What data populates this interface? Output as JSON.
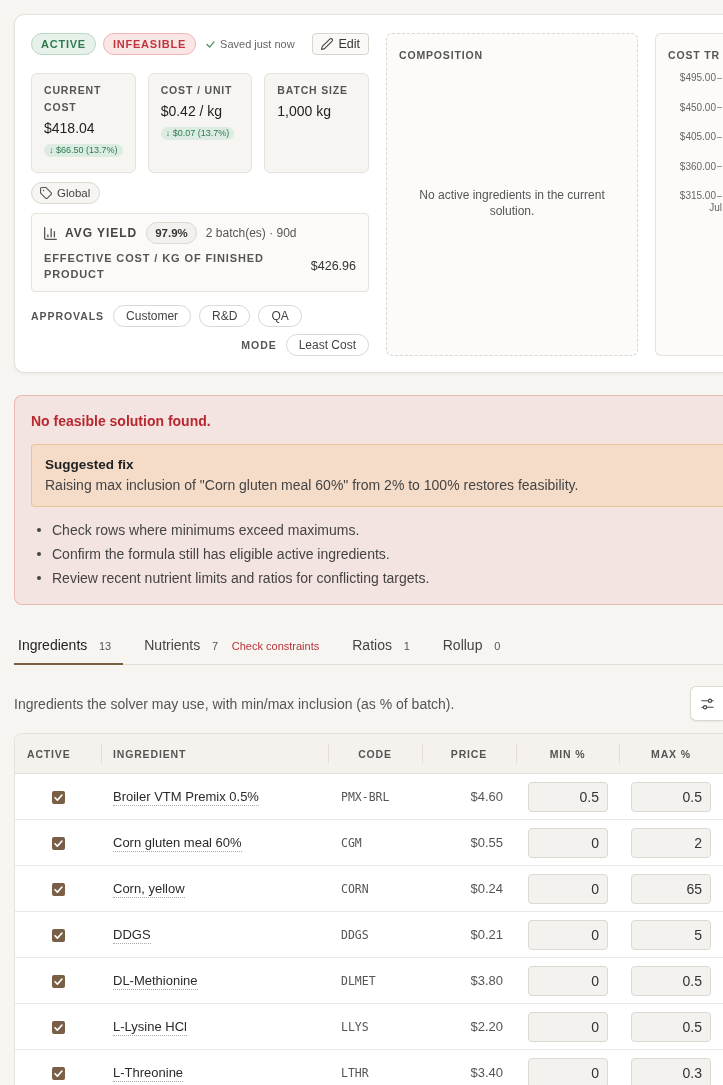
{
  "header": {
    "statuses": [
      {
        "label": "ACTIVE",
        "kind": "success"
      },
      {
        "label": "INFEASIBLE",
        "kind": "danger"
      }
    ],
    "save_status": "Saved just now",
    "edit_button": "Edit"
  },
  "metrics": [
    {
      "label": "CURRENT COST",
      "value": "$418.04",
      "delta": "↓ $66.50 (13.7%)"
    },
    {
      "label": "COST / UNIT",
      "value": "$0.42 / kg",
      "delta": "↓ $0.07 (13.7%)"
    },
    {
      "label": "BATCH SIZE",
      "value": "1,000 kg"
    }
  ],
  "tags": [
    "Global"
  ],
  "yield": {
    "label": "AVG YIELD",
    "value": "97.9%",
    "detail": "2 batch(es) · 90d",
    "effective_cost_label": "EFFECTIVE COST / KG OF FINISHED PRODUCT",
    "effective_cost_value": "$426.96"
  },
  "approvals": {
    "label": "APPROVALS",
    "items": [
      "Customer",
      "R&D",
      "QA"
    ]
  },
  "mode": {
    "label": "MODE",
    "value": "Least Cost"
  },
  "composition": {
    "title": "COMPOSITION",
    "empty_message": "No active ingredients in the current solution."
  },
  "cost_trend": {
    "title": "COST TR",
    "y_ticks": [
      "$495.00",
      "$450.00",
      "$405.00",
      "$360.00",
      "$315.00"
    ],
    "x_ticks": [
      "Jul"
    ]
  },
  "alert": {
    "title": "No feasible solution found.",
    "suggestion": {
      "title": "Suggested fix",
      "text": "Raising max inclusion of \"Corn gluten meal 60%\" from 2% to 100% restores feasibility."
    },
    "tips": [
      "Check rows where minimums exceed maximums.",
      "Confirm the formula still has eligible active ingredients.",
      "Review recent nutrient limits and ratios for conflicting targets."
    ]
  },
  "tabs": [
    {
      "label": "Ingredients",
      "count": "13",
      "selected": true
    },
    {
      "label": "Nutrients",
      "count": "7",
      "warning": "Check constraints",
      "selected": false
    },
    {
      "label": "Ratios",
      "count": "1",
      "selected": false
    },
    {
      "label": "Rollup",
      "count": "0",
      "selected": false
    }
  ],
  "description": "Ingredients the solver may use, with min/max inclusion (as % of batch).",
  "table": {
    "columns": [
      "ACTIVE",
      "INGREDIENT",
      "CODE",
      "PRICE",
      "MIN %",
      "MAX %"
    ],
    "rows": [
      {
        "active": true,
        "ingredient": "Broiler VTM Premix 0.5%",
        "code": "PMX-BRL",
        "price": "$4.60",
        "min": "0.5",
        "max": "0.5"
      },
      {
        "active": true,
        "ingredient": "Corn gluten meal 60%",
        "code": "CGM",
        "price": "$0.55",
        "min": "0",
        "max": "2"
      },
      {
        "active": true,
        "ingredient": "Corn, yellow",
        "code": "CORN",
        "price": "$0.24",
        "min": "0",
        "max": "65"
      },
      {
        "active": true,
        "ingredient": "DDGS",
        "code": "DDGS",
        "price": "$0.21",
        "min": "0",
        "max": "5"
      },
      {
        "active": true,
        "ingredient": "DL-Methionine",
        "code": "DLMET",
        "price": "$3.80",
        "min": "0",
        "max": "0.5"
      },
      {
        "active": true,
        "ingredient": "L-Lysine HCl",
        "code": "LLYS",
        "price": "$2.20",
        "min": "0",
        "max": "0.5"
      },
      {
        "active": true,
        "ingredient": "L-Threonine",
        "code": "LTHR",
        "price": "$3.40",
        "min": "0",
        "max": "0.3"
      }
    ]
  }
}
